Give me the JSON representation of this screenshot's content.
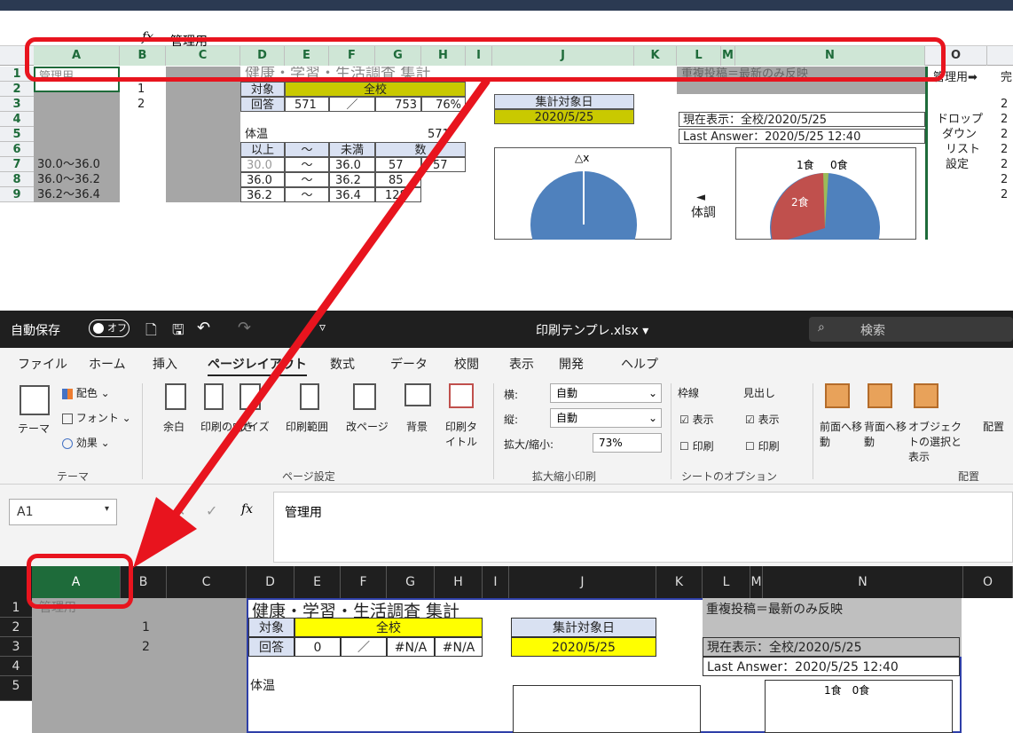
{
  "top": {
    "fx_icon": "fx",
    "formula_value": "管理用",
    "columns": [
      "A",
      "B",
      "C",
      "D",
      "E",
      "F",
      "G",
      "H",
      "I",
      "J",
      "K",
      "L",
      "M",
      "N",
      "O"
    ],
    "rows": [
      "1",
      "2",
      "3",
      "4",
      "5",
      "6",
      "7",
      "8",
      "9"
    ],
    "cells": {
      "a1": "管理用",
      "b2": "1",
      "b3": "2",
      "d1": "健康・学習・生活調査 集計",
      "d2": "対象",
      "f2": "全校",
      "d3": "回答",
      "e3": "571",
      "f3": "／",
      "g3": "753",
      "h3": "76%",
      "j2": "集計対象日",
      "j3": "2020/5/25",
      "d5": "体温",
      "h5": "571",
      "d6": "以上",
      "e6": "～",
      "f6": "未満",
      "g6": "数",
      "a7": "30.0～36.0",
      "d7": "30.0",
      "e7": "～",
      "f7": "36.0",
      "g7": "57",
      "h7": "57",
      "a8": "36.0～36.2",
      "d8": "36.0",
      "e8": "～",
      "f8": "36.2",
      "g8": "85",
      "a9": "36.2～36.4",
      "d9": "36.2",
      "e9": "～",
      "f9": "36.4",
      "g9": "128",
      "l1": "重複投稿＝最新のみ反映",
      "l3": "現在表示：全校/2020/5/25",
      "l4": "Last Answer：2020/5/25 12:40",
      "l7_arrow": "◄",
      "l7": "体調",
      "o1": "管理用➡",
      "o3": "ドロップ",
      "o4": "ダウン",
      "o5": "リスト",
      "o6": "設定",
      "p_col": [
        "完",
        "2",
        "2",
        "2",
        "2",
        "2",
        "2",
        "2",
        "2"
      ],
      "pie1_label": "△x",
      "pie2_labels": [
        "1食",
        "0食",
        "2食"
      ]
    }
  },
  "window": {
    "autosave": "自動保存",
    "autosave_state": "オフ",
    "filename": "印刷テンプレ.xlsx ▾",
    "search": "検索",
    "tabs": [
      "ファイル",
      "ホーム",
      "挿入",
      "ページレイアウト",
      "数式",
      "データ",
      "校閲",
      "表示",
      "開発",
      "ヘルプ"
    ],
    "active_tab": "ページレイアウト",
    "ribbon": {
      "theme_label": "テーマ",
      "colors": "配色 ⌄",
      "fonts": "フォント ⌄",
      "effects": "効果 ⌄",
      "theme_group": "テーマ",
      "margins": "余白",
      "orientation": "印刷の向き",
      "size": "サイズ",
      "print_area": "印刷範囲",
      "breaks": "改ページ",
      "background": "背景",
      "print_titles": "印刷タイトル",
      "page_setup_group": "ページ設定",
      "width_label": "横:",
      "width_value": "自動",
      "height_label": "縦:",
      "height_value": "自動",
      "scale_label": "拡大/縮小:",
      "scale_value": "73%",
      "scale_group": "拡大縮小印刷",
      "gridlines": "枠線",
      "headings": "見出し",
      "view": "表示",
      "print": "印刷",
      "sheet_options_group": "シートのオプション",
      "bring_forward": "前面へ移動",
      "send_backward": "背面へ移動",
      "selection_pane": "オブジェクトの選択と表示",
      "align": "配置",
      "arrange_group": "配置"
    },
    "namebox": "A1",
    "fx_icon": "fx",
    "formula_value": "管理用",
    "grid": {
      "columns": [
        "A",
        "B",
        "C",
        "D",
        "E",
        "F",
        "G",
        "H",
        "I",
        "J",
        "K",
        "L",
        "M",
        "N",
        "O"
      ],
      "rows": [
        "1",
        "2",
        "3",
        "4",
        "5"
      ],
      "a1": "管理用",
      "b2": "1",
      "b3": "2",
      "d1": "健康・学習・生活調査 集計",
      "d2": "対象",
      "f2": "全校",
      "d3": "回答",
      "e3": "0",
      "f3": "／",
      "g3": "#N/A",
      "h3": "#N/A",
      "j2": "集計対象日",
      "j3": "2020/5/25",
      "d5": "体温",
      "l1": "重複投稿＝最新のみ反映",
      "l3": "現在表示：全校/2020/5/25",
      "l4": "Last Answer：2020/5/25 12:40",
      "meals": "1食　0食"
    }
  }
}
